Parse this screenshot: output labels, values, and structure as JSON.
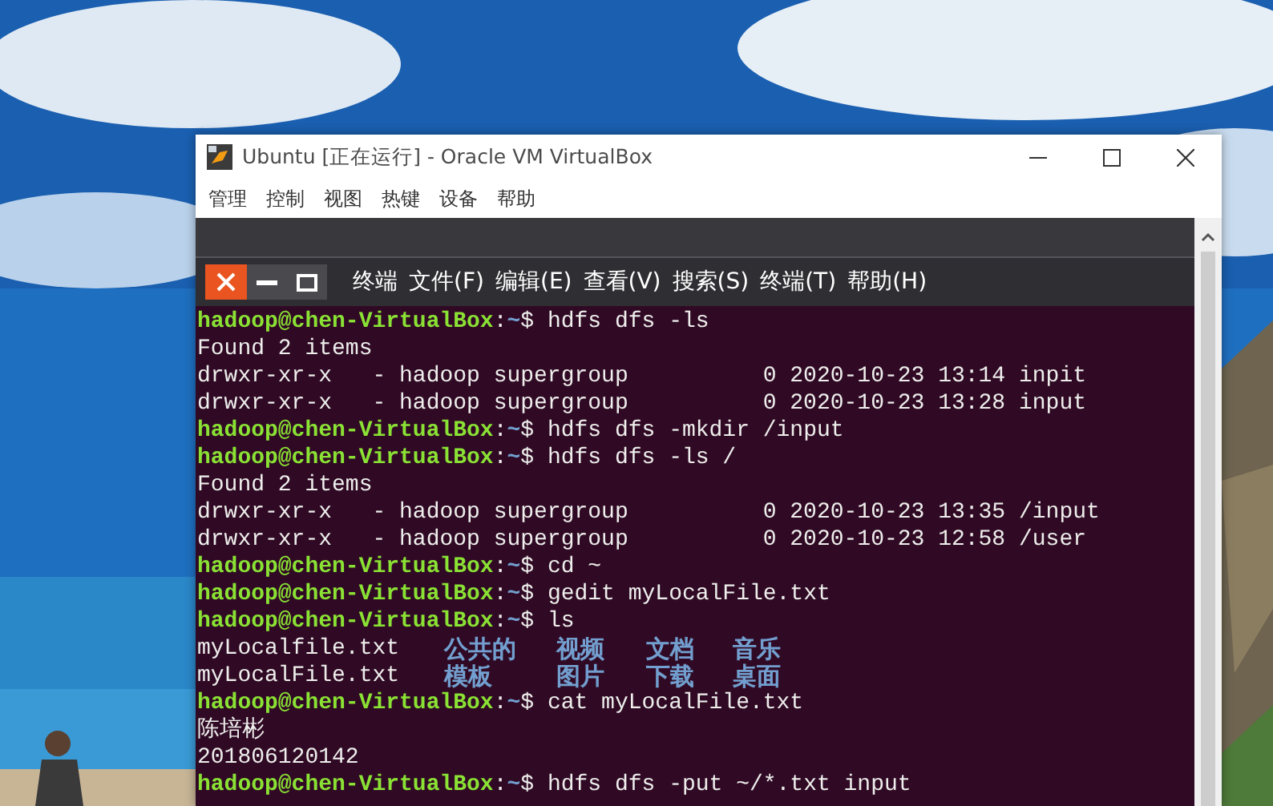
{
  "window": {
    "title": "Ubuntu [正在运行] - Oracle VM VirtualBox"
  },
  "menu": [
    "管理",
    "控制",
    "视图",
    "热键",
    "设备",
    "帮助"
  ],
  "terminal": {
    "menu": [
      "终端",
      "文件(F)",
      "编辑(E)",
      "查看(V)",
      "搜索(S)",
      "终端(T)",
      "帮助(H)"
    ],
    "lines": [
      {
        "kind": "prompt",
        "user": "hadoop@chen-VirtualBox",
        "sep": ":",
        "dir": "~",
        "sign": "$",
        "command": "hdfs dfs -ls"
      },
      {
        "kind": "output",
        "text": "Found 2 items"
      },
      {
        "kind": "output",
        "text": "drwxr-xr-x   - hadoop supergroup          0 2020-10-23 13:14 inpit"
      },
      {
        "kind": "output",
        "text": "drwxr-xr-x   - hadoop supergroup          0 2020-10-23 13:28 input"
      },
      {
        "kind": "prompt",
        "user": "hadoop@chen-VirtualBox",
        "sep": ":",
        "dir": "~",
        "sign": "$",
        "command": "hdfs dfs -mkdir /input"
      },
      {
        "kind": "prompt",
        "user": "hadoop@chen-VirtualBox",
        "sep": ":",
        "dir": "~",
        "sign": "$",
        "command": "hdfs dfs -ls /"
      },
      {
        "kind": "output",
        "text": "Found 2 items"
      },
      {
        "kind": "output",
        "text": "drwxr-xr-x   - hadoop supergroup          0 2020-10-23 13:35 /input"
      },
      {
        "kind": "output",
        "text": "drwxr-xr-x   - hadoop supergroup          0 2020-10-23 12:58 /user"
      },
      {
        "kind": "prompt",
        "user": "hadoop@chen-VirtualBox",
        "sep": ":",
        "dir": "~",
        "sign": "$",
        "command": "cd ~"
      },
      {
        "kind": "prompt",
        "user": "hadoop@chen-VirtualBox",
        "sep": ":",
        "dir": "~",
        "sign": "$",
        "command": "gedit myLocalFile.txt"
      },
      {
        "kind": "prompt",
        "user": "hadoop@chen-VirtualBox",
        "sep": ":",
        "dir": "~",
        "sign": "$",
        "command": "ls"
      },
      {
        "kind": "listing",
        "entries": [
          {
            "name": "myLocalfile.txt",
            "kind": "file"
          },
          {
            "name": "公共的",
            "kind": "dir"
          },
          {
            "name": "视频",
            "kind": "dir"
          },
          {
            "name": "文档",
            "kind": "dir"
          },
          {
            "name": "音乐",
            "kind": "dir"
          }
        ]
      },
      {
        "kind": "listing",
        "entries": [
          {
            "name": "myLocalFile.txt",
            "kind": "file"
          },
          {
            "name": "模板",
            "kind": "dir"
          },
          {
            "name": "图片",
            "kind": "dir"
          },
          {
            "name": "下载",
            "kind": "dir"
          },
          {
            "name": "桌面",
            "kind": "dir"
          }
        ]
      },
      {
        "kind": "prompt",
        "user": "hadoop@chen-VirtualBox",
        "sep": ":",
        "dir": "~",
        "sign": "$",
        "command": "cat myLocalFile.txt"
      },
      {
        "kind": "output",
        "text": "陈培彬"
      },
      {
        "kind": "output",
        "text": "201806120142"
      },
      {
        "kind": "prompt",
        "user": "hadoop@chen-VirtualBox",
        "sep": ":",
        "dir": "~",
        "sign": "$",
        "command": "hdfs dfs -put ~/*.txt input"
      }
    ]
  }
}
